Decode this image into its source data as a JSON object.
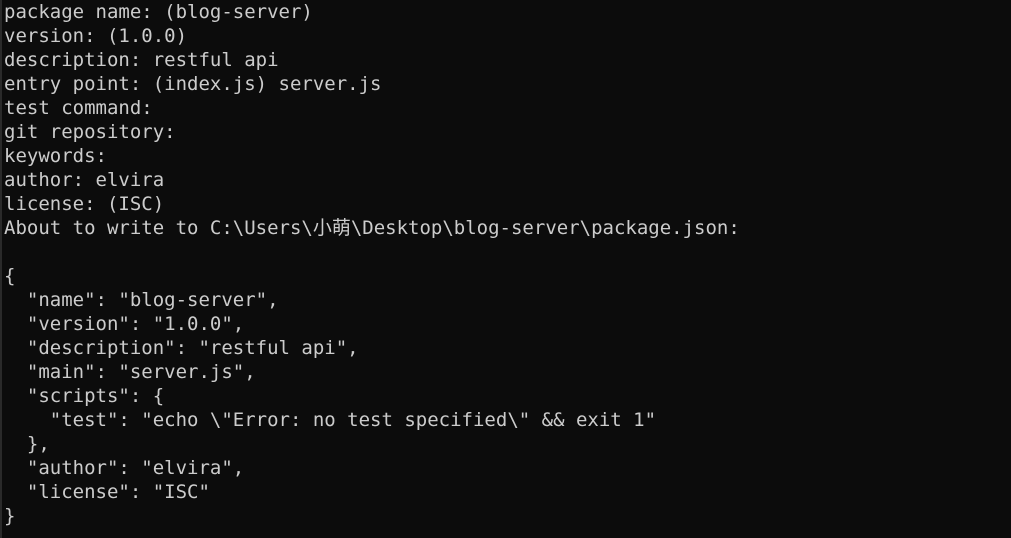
{
  "terminal": {
    "lines": [
      "package name: (blog-server)",
      "version: (1.0.0)",
      "description: restful api",
      "entry point: (index.js) server.js",
      "test command:",
      "git repository:",
      "keywords:",
      "author: elvira",
      "license: (ISC)",
      "About to write to C:\\Users\\小萌\\Desktop\\blog-server\\package.json:",
      "",
      "{",
      "  \"name\": \"blog-server\",",
      "  \"version\": \"1.0.0\",",
      "  \"description\": \"restful api\",",
      "  \"main\": \"server.js\",",
      "  \"scripts\": {",
      "    \"test\": \"echo \\\"Error: no test specified\\\" && exit 1\"",
      "  },",
      "  \"author\": \"elvira\",",
      "  \"license\": \"ISC\"",
      "}"
    ],
    "colors": {
      "background": "#0c0c0c",
      "foreground": "#cccccc"
    }
  }
}
